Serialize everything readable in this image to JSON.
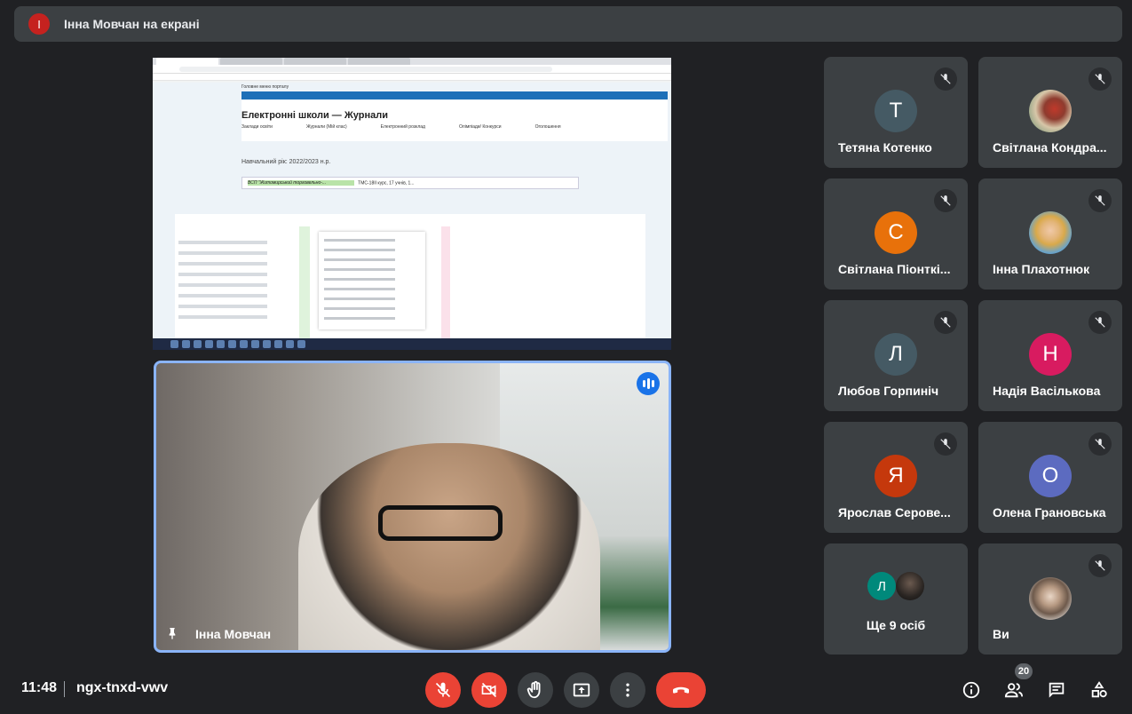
{
  "banner": {
    "avatar_letter": "І",
    "text": "Інна Мовчан на екрані"
  },
  "shared_screen": {
    "site_header": "Головне меню порталу",
    "page_title": "Електронні школи — Журнали",
    "nav_tabs": [
      "Заклади освіти",
      "Журнали (Мій клас)",
      "Електронний розклад",
      "Олімпіади/ Конкурси",
      "Оголошення"
    ],
    "school_year": "Навчальний рік: 2022/2023 н.р.",
    "institution": "ВСП \"Житомирський торговельно-...",
    "group": "ТМС-18II курс, 17 учнів, 1..."
  },
  "speaker": {
    "name": "Інна Мовчан"
  },
  "participants": [
    {
      "letter": "Т",
      "name": "Тетяна Котенко",
      "color": "#455a64"
    },
    {
      "letter": "",
      "name": "Світлана Кондра...",
      "photo": true
    },
    {
      "letter": "С",
      "name": "Світлана Піонткі...",
      "color": "#e8710a"
    },
    {
      "letter": "",
      "name": "Інна Плахотнюк",
      "photo": true
    },
    {
      "letter": "Л",
      "name": "Любов Горпиніч",
      "color": "#455a64"
    },
    {
      "letter": "Н",
      "name": "Надія Васількова",
      "color": "#d81b60"
    },
    {
      "letter": "Я",
      "name": "Ярослав Серове...",
      "color": "#c5380c"
    },
    {
      "letter": "О",
      "name": "Олена Грановська",
      "color": "#5c6bc0"
    }
  ],
  "more": {
    "letter": "Л",
    "label": "Ще 9 осіб"
  },
  "self": {
    "name": "Ви"
  },
  "bottom": {
    "time": "11:48",
    "meeting_code": "ngx-tnxd-vwv",
    "participants_count": "20"
  },
  "colors": {
    "background": "#202124",
    "tile": "#3c4043",
    "accent": "#8ab4f8",
    "danger": "#ea4335"
  }
}
